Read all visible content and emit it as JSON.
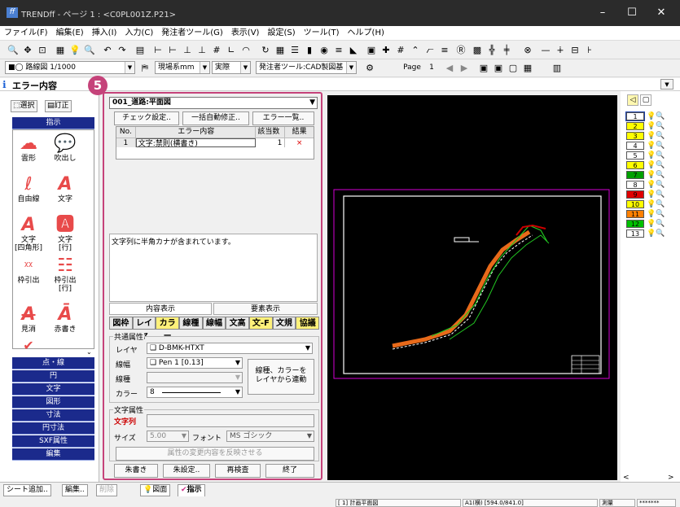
{
  "window": {
    "title": "TRENDff - ページ 1 : <C0PL001Z.P21>",
    "logo": "ff"
  },
  "menu": [
    "ファイル(F)",
    "編集(E)",
    "挿入(I)",
    "入力(C)",
    "発注者ツール(G)",
    "表示(V)",
    "設定(S)",
    "ツール(T)",
    "ヘルプ(H)"
  ],
  "toolbar2": {
    "layer": "■◯ 路線図 1/1000",
    "units": "現場系mm",
    "scale": "実際",
    "tool": "発注者ツール:CAD製図基",
    "page_label": "Page",
    "page_num": "1"
  },
  "pane_title": "エラー内容",
  "step_badge": "5",
  "left": {
    "select_btn": "選択",
    "correct_btn": "訂正",
    "header": "指示",
    "tools": [
      {
        "label": "雲形"
      },
      {
        "label": "吹出し"
      },
      {
        "label": "自由線"
      },
      {
        "label": "文字"
      },
      {
        "label": "文字\n[四角形]"
      },
      {
        "label": "文字\n[行]"
      },
      {
        "label": "枠引出"
      },
      {
        "label": "枠引出\n[行]"
      },
      {
        "label": "見消"
      },
      {
        "label": "赤書き"
      }
    ],
    "categories": [
      "点・線",
      "円",
      "文字",
      "図形",
      "寸法",
      "円寸法",
      "SXF属性",
      "編集"
    ]
  },
  "dialog": {
    "drawing": "001_道路:平面図",
    "check_btn": "チェック設定..",
    "auto_fix_btn": "一括自動修正..",
    "error_list_btn": "エラー一覧..",
    "table": {
      "headers": [
        "No.",
        "エラー内容",
        "該当数",
        "結果"
      ],
      "rows": [
        {
          "no": "1",
          "content": "文字:禁則(横書き)",
          "count": "1",
          "result": "×"
        }
      ]
    },
    "message": "文字列に半角カナが含まれています。",
    "tab_content": "内容表示",
    "tab_elements": "要素表示",
    "prop_tabs": [
      "図枠",
      "レイヤ",
      "カラー",
      "線種",
      "線幅",
      "文高",
      "文-F",
      "文規",
      "協議"
    ],
    "common_attr": "共通属性",
    "layer_label": "レイヤ",
    "layer_value": "❑ D-BMK-HTXT",
    "linewidth_label": "線幅",
    "linewidth_value": "❑ Pen 1  [0.13]",
    "linetype_label": "線種",
    "color_label": "カラー",
    "color_value": "8",
    "link_btn": "線種、カラーを\nレイヤから連動",
    "text_attr": "文字属性",
    "text_label": "文字列",
    "size_label": "サイズ",
    "size_value": "5.00",
    "font_label": "フォント",
    "font_value": "MS ゴシック",
    "apply_btn": "属性の変更内容を反映させる",
    "red_btn": "朱書き",
    "red_settings_btn": "朱設定..",
    "recheck_btn": "再検査",
    "end_btn": "終了"
  },
  "layers": [
    {
      "no": "1",
      "color": "#ffffff"
    },
    {
      "no": "2",
      "color": "#ffff00"
    },
    {
      "no": "3",
      "color": "#ffff00"
    },
    {
      "no": "4",
      "color": "#ffffff"
    },
    {
      "no": "5",
      "color": "#ffffff"
    },
    {
      "no": "6",
      "color": "#ffff00"
    },
    {
      "no": "7",
      "color": "#00a000"
    },
    {
      "no": "8",
      "color": "#ffffff"
    },
    {
      "no": "9",
      "color": "#e00000"
    },
    {
      "no": "10",
      "color": "#ffff00"
    },
    {
      "no": "11",
      "color": "#ff8000"
    },
    {
      "no": "12",
      "color": "#00c000"
    },
    {
      "no": "13",
      "color": "#ffffff"
    }
  ],
  "bottom": {
    "add_sheet": "シート追加..",
    "edit": "編集..",
    "delete": "削除",
    "drawing_tab": "図面",
    "instruct_tab": "指示",
    "status": [
      "[ 1] 計画平面図",
      "A1(横) [594.0/841.0]",
      "測量",
      "*******"
    ]
  }
}
